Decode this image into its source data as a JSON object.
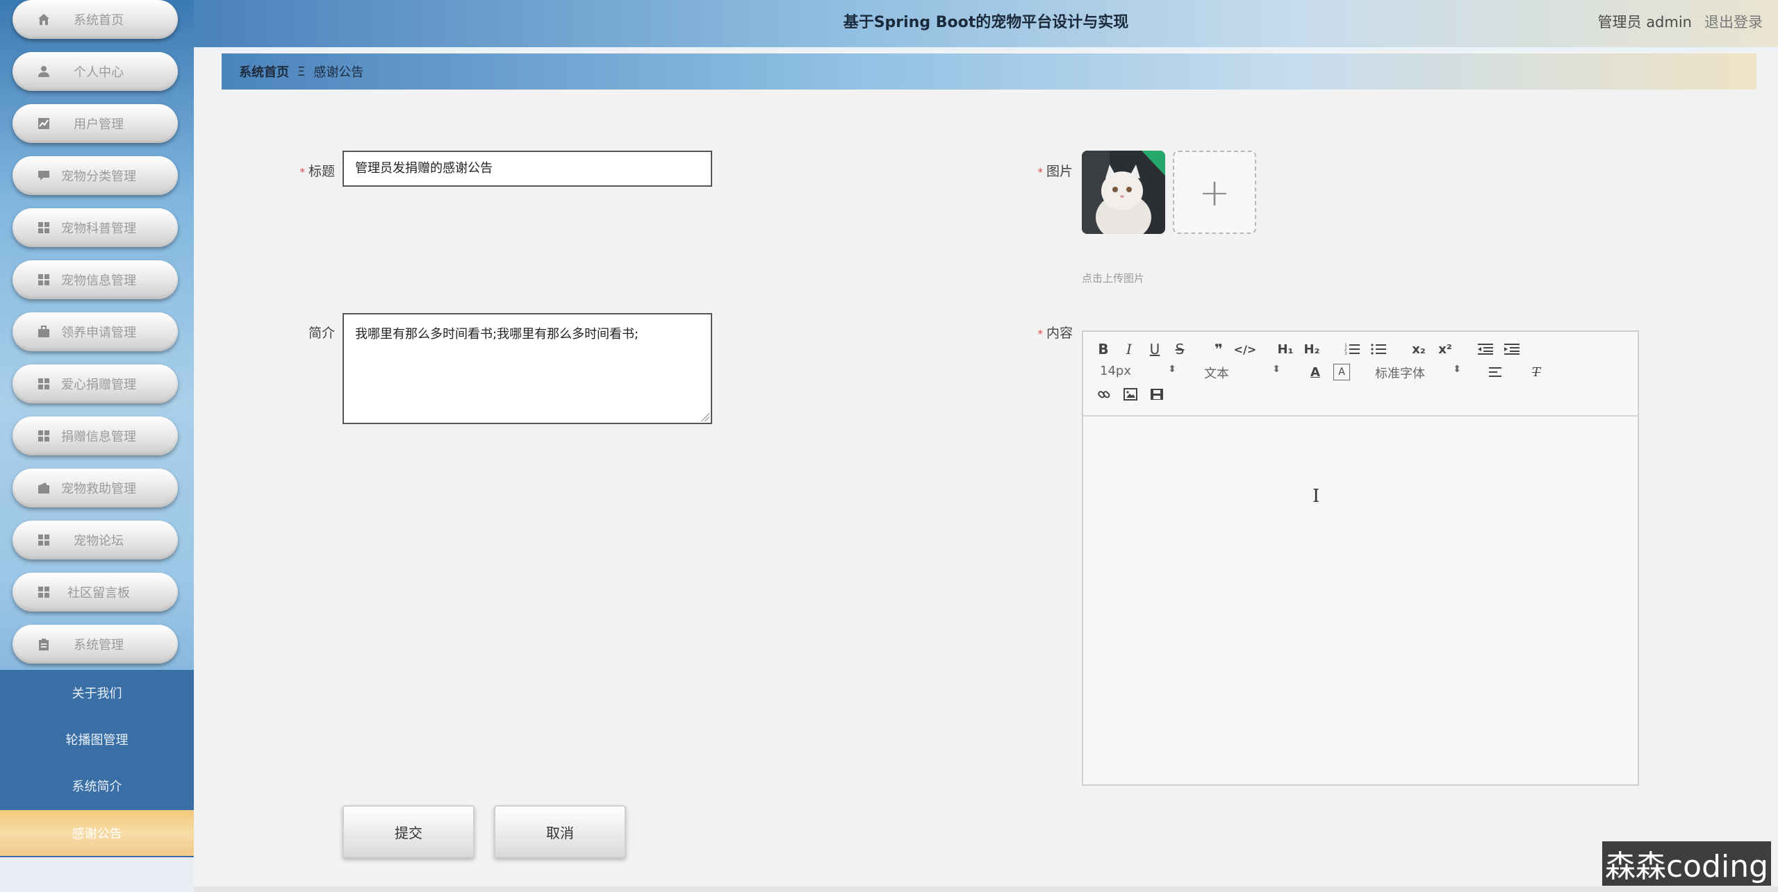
{
  "app": {
    "title": "基于Spring Boot的宠物平台设计与实现",
    "user": "管理员 admin",
    "logout": "退出登录"
  },
  "sidebar": {
    "items": [
      {
        "label": "系统首页",
        "icon": "home-icon"
      },
      {
        "label": "个人中心",
        "icon": "user-icon"
      },
      {
        "label": "用户管理",
        "icon": "chart-icon"
      },
      {
        "label": "宠物分类管理",
        "icon": "chat-icon"
      },
      {
        "label": "宠物科普管理",
        "icon": "grid-icon"
      },
      {
        "label": "宠物信息管理",
        "icon": "grid-icon"
      },
      {
        "label": "领养申请管理",
        "icon": "briefcase-icon"
      },
      {
        "label": "爱心捐赠管理",
        "icon": "grid-icon"
      },
      {
        "label": "捐赠信息管理",
        "icon": "grid-icon"
      },
      {
        "label": "宠物救助管理",
        "icon": "wallet-icon"
      },
      {
        "label": "宠物论坛",
        "icon": "grid-icon"
      },
      {
        "label": "社区留言板",
        "icon": "grid-icon"
      },
      {
        "label": "系统管理",
        "icon": "clipboard-icon"
      }
    ],
    "sub_items": [
      {
        "label": "关于我们"
      },
      {
        "label": "轮播图管理"
      },
      {
        "label": "系统简介"
      },
      {
        "label": "感谢公告",
        "active": true
      }
    ]
  },
  "breadcrumb": {
    "home": "系统首页",
    "separator": "Ξ",
    "current": "感谢公告"
  },
  "form": {
    "title_label": "标题",
    "title_value": "管理员发捐赠的感谢公告",
    "intro_label": "简介",
    "intro_value": "我哪里有那么多时间看书;我哪里有那么多时间看书;",
    "image_label": "图片",
    "upload_tip": "点击上传图片",
    "add_symbol": "+",
    "content_label": "内容",
    "required_mark": "*"
  },
  "editor": {
    "font_size": "14px",
    "header_type": "文本",
    "font_family": "标准字体"
  },
  "buttons": {
    "submit": "提交",
    "cancel": "取消"
  },
  "watermark": "森森coding"
}
